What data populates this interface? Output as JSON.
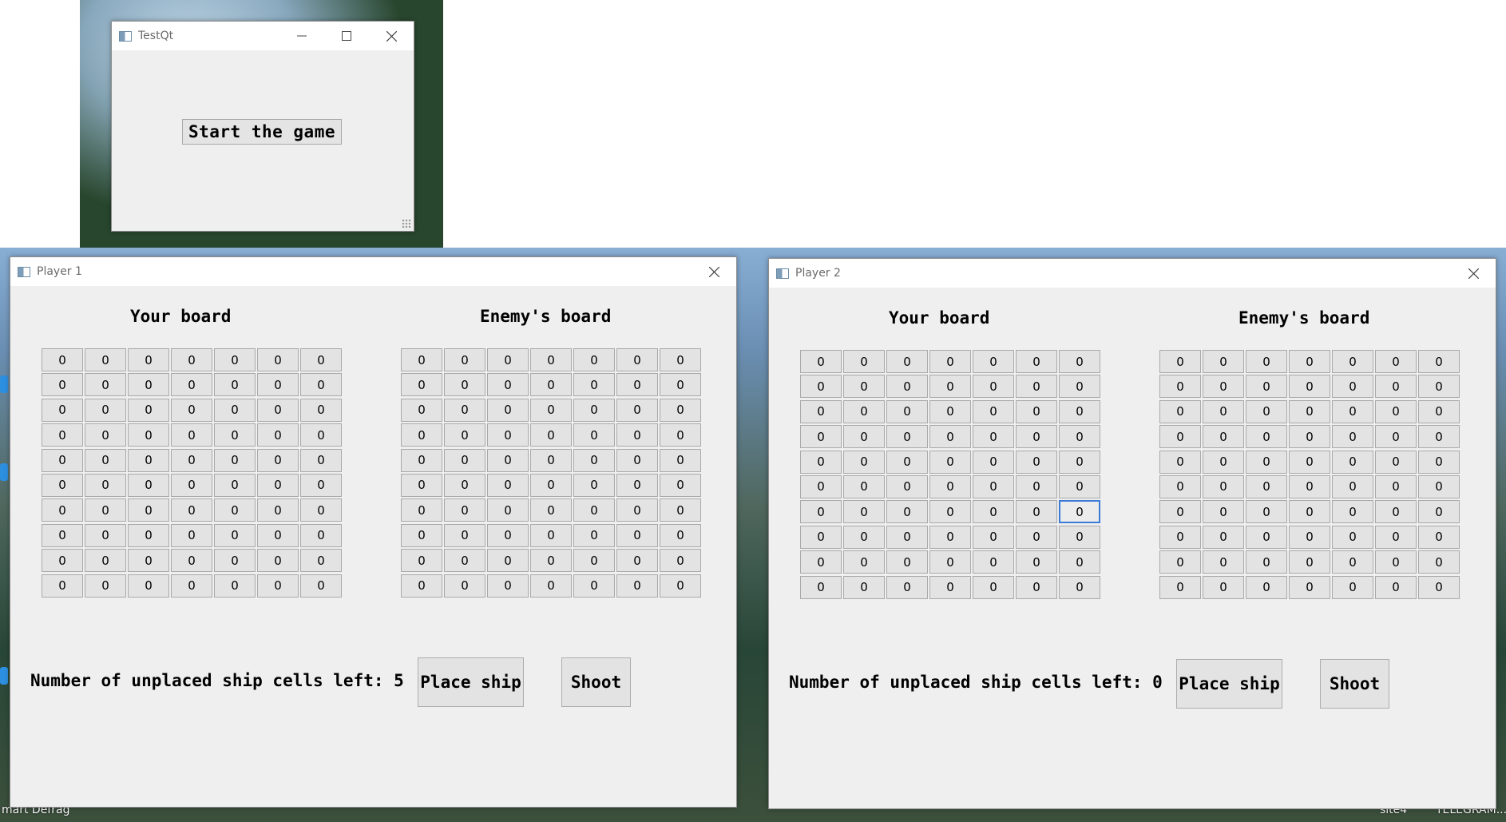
{
  "start_window": {
    "title": "TestQt",
    "start_button_label": "Start the game"
  },
  "players": [
    {
      "window_title": "Player 1",
      "your_board_label": "Your board",
      "enemy_board_label": "Enemy's board",
      "status_label": "Number of unplaced ship cells left:",
      "cells_left": "5",
      "place_ship_label": "Place ship",
      "shoot_label": "Shoot",
      "your_board": [
        [
          "0",
          "0",
          "0",
          "0",
          "0",
          "0",
          "0"
        ],
        [
          "0",
          "0",
          "0",
          "0",
          "0",
          "0",
          "0"
        ],
        [
          "0",
          "0",
          "0",
          "0",
          "0",
          "0",
          "0"
        ],
        [
          "0",
          "0",
          "0",
          "0",
          "0",
          "0",
          "0"
        ],
        [
          "0",
          "0",
          "0",
          "0",
          "0",
          "0",
          "0"
        ],
        [
          "0",
          "0",
          "0",
          "0",
          "0",
          "0",
          "0"
        ],
        [
          "0",
          "0",
          "0",
          "0",
          "0",
          "0",
          "0"
        ],
        [
          "0",
          "0",
          "0",
          "0",
          "0",
          "0",
          "0"
        ],
        [
          "0",
          "0",
          "0",
          "0",
          "0",
          "0",
          "0"
        ],
        [
          "0",
          "0",
          "0",
          "0",
          "0",
          "0",
          "0"
        ]
      ],
      "enemy_board": [
        [
          "0",
          "0",
          "0",
          "0",
          "0",
          "0",
          "0"
        ],
        [
          "0",
          "0",
          "0",
          "0",
          "0",
          "0",
          "0"
        ],
        [
          "0",
          "0",
          "0",
          "0",
          "0",
          "0",
          "0"
        ],
        [
          "0",
          "0",
          "0",
          "0",
          "0",
          "0",
          "0"
        ],
        [
          "0",
          "0",
          "0",
          "0",
          "0",
          "0",
          "0"
        ],
        [
          "0",
          "0",
          "0",
          "0",
          "0",
          "0",
          "0"
        ],
        [
          "0",
          "0",
          "0",
          "0",
          "0",
          "0",
          "0"
        ],
        [
          "0",
          "0",
          "0",
          "0",
          "0",
          "0",
          "0"
        ],
        [
          "0",
          "0",
          "0",
          "0",
          "0",
          "0",
          "0"
        ],
        [
          "0",
          "0",
          "0",
          "0",
          "0",
          "0",
          "0"
        ]
      ]
    },
    {
      "window_title": "Player 2",
      "your_board_label": "Your board",
      "enemy_board_label": "Enemy's board",
      "status_label": "Number of unplaced ship cells left:",
      "cells_left": "0",
      "place_ship_label": "Place ship",
      "shoot_label": "Shoot",
      "focused_cell": {
        "board": "your_board",
        "row": 6,
        "col": 6
      },
      "your_board": [
        [
          "0",
          "0",
          "0",
          "0",
          "0",
          "0",
          "0"
        ],
        [
          "0",
          "0",
          "0",
          "0",
          "0",
          "0",
          "0"
        ],
        [
          "0",
          "0",
          "0",
          "0",
          "0",
          "0",
          "0"
        ],
        [
          "0",
          "0",
          "0",
          "0",
          "0",
          "0",
          "0"
        ],
        [
          "0",
          "0",
          "0",
          "0",
          "0",
          "0",
          "0"
        ],
        [
          "0",
          "0",
          "0",
          "0",
          "0",
          "0",
          "0"
        ],
        [
          "0",
          "0",
          "0",
          "0",
          "0",
          "0",
          "0"
        ],
        [
          "0",
          "0",
          "0",
          "0",
          "0",
          "0",
          "0"
        ],
        [
          "0",
          "0",
          "0",
          "0",
          "0",
          "0",
          "0"
        ],
        [
          "0",
          "0",
          "0",
          "0",
          "0",
          "0",
          "0"
        ]
      ],
      "enemy_board": [
        [
          "0",
          "0",
          "0",
          "0",
          "0",
          "0",
          "0"
        ],
        [
          "0",
          "0",
          "0",
          "0",
          "0",
          "0",
          "0"
        ],
        [
          "0",
          "0",
          "0",
          "0",
          "0",
          "0",
          "0"
        ],
        [
          "0",
          "0",
          "0",
          "0",
          "0",
          "0",
          "0"
        ],
        [
          "0",
          "0",
          "0",
          "0",
          "0",
          "0",
          "0"
        ],
        [
          "0",
          "0",
          "0",
          "0",
          "0",
          "0",
          "0"
        ],
        [
          "0",
          "0",
          "0",
          "0",
          "0",
          "0",
          "0"
        ],
        [
          "0",
          "0",
          "0",
          "0",
          "0",
          "0",
          "0"
        ],
        [
          "0",
          "0",
          "0",
          "0",
          "0",
          "0",
          "0"
        ],
        [
          "0",
          "0",
          "0",
          "0",
          "0",
          "0",
          "0"
        ]
      ]
    }
  ],
  "desktop": {
    "labels": [
      "mart Defrag",
      "site4",
      "TELEGRAM..."
    ],
    "accent_color": "#3b7bd6"
  }
}
